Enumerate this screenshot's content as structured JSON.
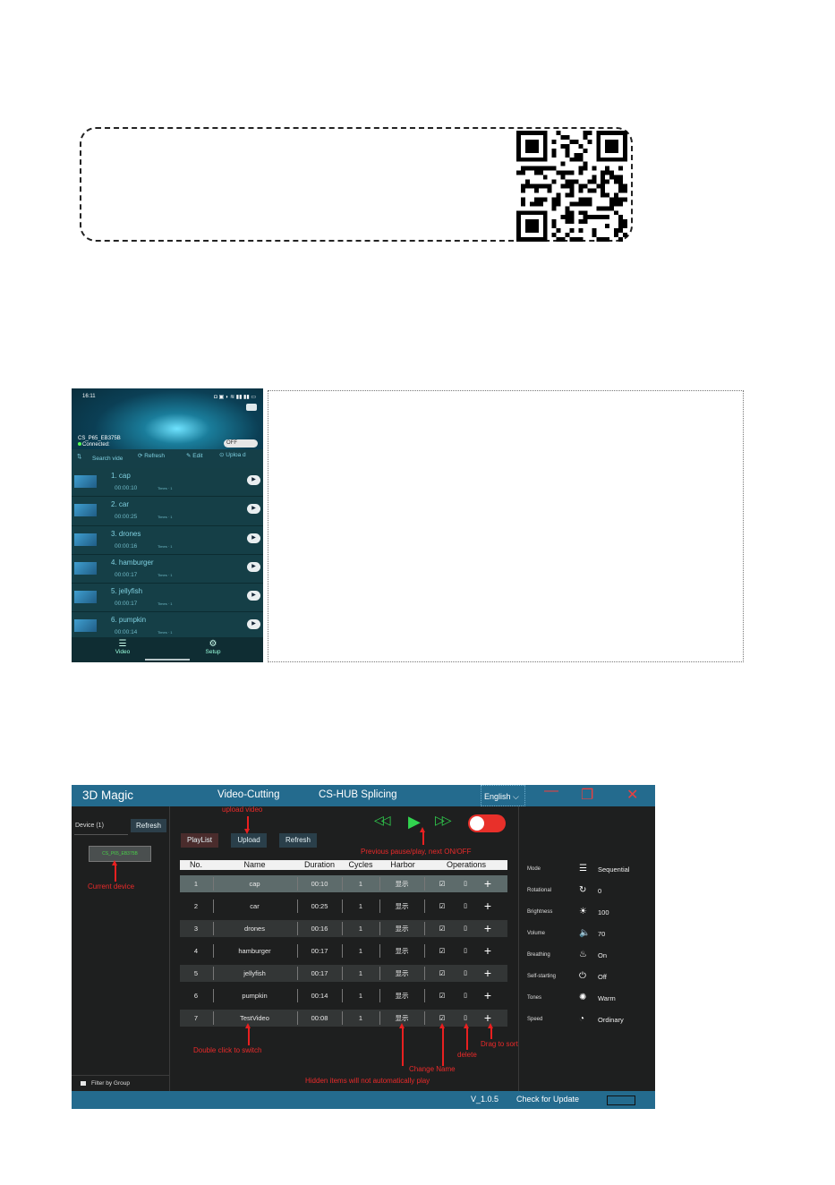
{
  "phone": {
    "time": "16:11",
    "status_icons": "◘ ▣ ◗ ≋ ▮▮ ▮▮ ▭",
    "device_name": "CS_P65_EB375B",
    "connection": "Connected",
    "toggle_label": "OFF",
    "toolbar": {
      "search": "Search vide",
      "refresh": "Refresh",
      "edit": "Edit",
      "upload": "Uploa d"
    },
    "videos": [
      {
        "title": "1. cap",
        "duration": "00:00:10",
        "times": "Times · 1"
      },
      {
        "title": "2. car",
        "duration": "00:00:25",
        "times": "Times · 1"
      },
      {
        "title": "3. drones",
        "duration": "00:00:16",
        "times": "Times · 1"
      },
      {
        "title": "4. hamburger",
        "duration": "00:00:17",
        "times": "Times · 1"
      },
      {
        "title": "5. jellyfish",
        "duration": "00:00:17",
        "times": "Times · 1"
      },
      {
        "title": "6. pumpkin",
        "duration": "00:00:14",
        "times": "Times · 1"
      }
    ],
    "nav": {
      "video": "Video",
      "setup": "Setup"
    }
  },
  "app": {
    "title": "3D Magic",
    "tabs": [
      "Video-Cutting",
      "CS-HUB Splicing"
    ],
    "language": "English",
    "left": {
      "device_label": "Device  (1)",
      "refresh": "Refresh",
      "current_device": "CS_P65_EB375B",
      "filter": "Filter by Group"
    },
    "buttons": {
      "playlist": "PlayList",
      "upload": "Upload",
      "refresh": "Refresh"
    },
    "table": {
      "headers": [
        "No.",
        "Name",
        "Duration",
        "Cycles",
        "Harbor",
        "Operations"
      ],
      "rows": [
        {
          "no": "1",
          "name": "cap",
          "duration": "00:10",
          "cycles": "1",
          "harbor": "显示"
        },
        {
          "no": "2",
          "name": "car",
          "duration": "00:25",
          "cycles": "1",
          "harbor": "显示"
        },
        {
          "no": "3",
          "name": "drones",
          "duration": "00:16",
          "cycles": "1",
          "harbor": "显示"
        },
        {
          "no": "4",
          "name": "hamburger",
          "duration": "00:17",
          "cycles": "1",
          "harbor": "显示"
        },
        {
          "no": "5",
          "name": "jellyfish",
          "duration": "00:17",
          "cycles": "1",
          "harbor": "显示"
        },
        {
          "no": "6",
          "name": "pumpkin",
          "duration": "00:14",
          "cycles": "1",
          "harbor": "显示"
        },
        {
          "no": "7",
          "name": "TestVideo",
          "duration": "00:08",
          "cycles": "1",
          "harbor": "显示"
        }
      ]
    },
    "settings": [
      {
        "label": "Mode",
        "icon": "list-icon",
        "value": "Sequential"
      },
      {
        "label": "Rotational",
        "icon": "rotate-icon",
        "value": "0"
      },
      {
        "label": "Brightness",
        "icon": "sun-icon",
        "value": "100"
      },
      {
        "label": "Volume",
        "icon": "speaker-icon",
        "value": "70"
      },
      {
        "label": "Breathing",
        "icon": "lamp-icon",
        "value": "On"
      },
      {
        "label": "Self-starting",
        "icon": "power-icon",
        "value": "Off"
      },
      {
        "label": "Tones",
        "icon": "tone-icon",
        "value": "Warm"
      },
      {
        "label": "Speed",
        "icon": "gauge-icon",
        "value": "Ordinary"
      }
    ],
    "status": {
      "version": "V_1.0.5",
      "update": "Check for Update"
    }
  },
  "annotations": {
    "upload_video": "upload video",
    "controls": "Previous  pause/play, next  ON/OFF",
    "current_device": "Current  device",
    "double_click": "Double click to switch",
    "drag_to_sort": "Drag to sort",
    "delete": "delete",
    "change_name": "Change Name",
    "hidden_items": "Hidden items will not automatically play"
  },
  "colors": {
    "title_bar": "#246b8e",
    "annotation": "#ea2a2a",
    "play_green": "#31d44f",
    "toggle_red": "#e8302a"
  }
}
